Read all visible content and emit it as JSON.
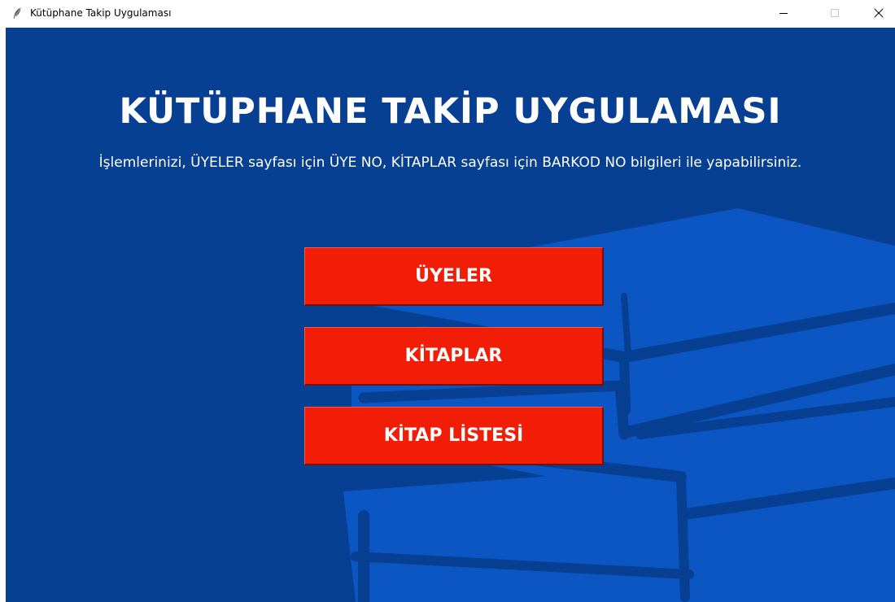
{
  "window": {
    "title": "Kütüphane Takip Uygulaması",
    "controls": {
      "minimize_icon": "minimize-icon",
      "maximize_icon": "maximize-icon",
      "close_icon": "close-icon"
    }
  },
  "main": {
    "title": "KÜTÜPHANE TAKİP UYGULAMASI",
    "subtitle": "İşlemlerinizi, ÜYELER sayfası için ÜYE NO, KİTAPLAR sayfası için BARKOD NO bilgileri ile yapabilirsiniz.",
    "buttons": [
      {
        "label": "ÜYELER"
      },
      {
        "label": "KİTAPLAR"
      },
      {
        "label": "KİTAP LİSTESİ"
      }
    ]
  },
  "colors": {
    "background": "#073f93",
    "book_graphic": "#0b56c2",
    "button": "#f21d06",
    "text": "#ffffff"
  },
  "icons": {
    "app_icon": "feather-icon",
    "background_graphic": "stacked-books-icon"
  }
}
